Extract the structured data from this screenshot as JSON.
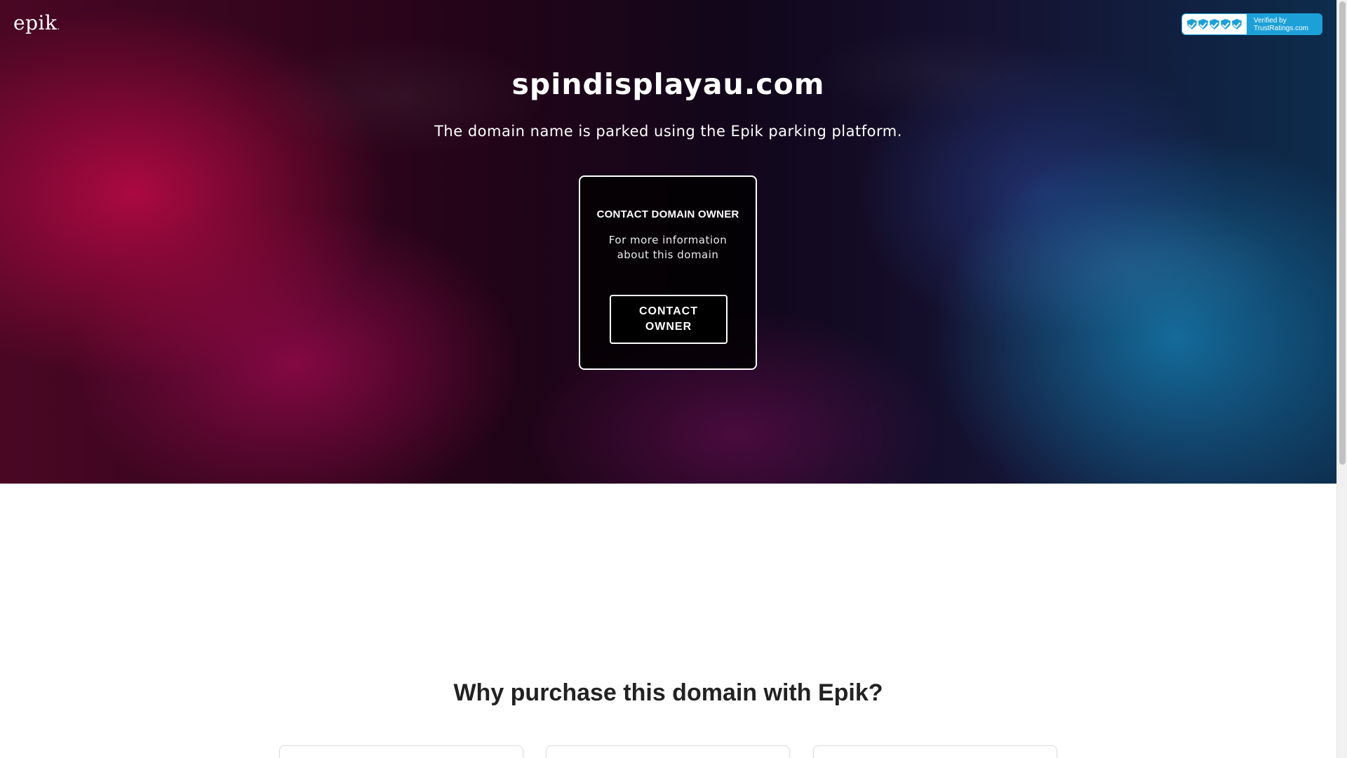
{
  "header": {
    "logo_text": "epik",
    "logo_dot": ".",
    "trust_badge": {
      "line1": "Verified by",
      "line2": "TrustRatings.com",
      "icon": "shield-check-icon",
      "shield_count": 5,
      "color": "#1da0d8"
    }
  },
  "hero": {
    "domain": "spindisplayau.com",
    "subtitle": "The domain name is parked using the Epik parking platform."
  },
  "contact_card": {
    "heading": "CONTACT DOMAIN OWNER",
    "description": "For more information about this domain",
    "button_label": "CONTACT OWNER"
  },
  "why_section": {
    "heading": "Why purchase this domain with Epik?"
  },
  "colors": {
    "hero_magenta": "#be0a46",
    "hero_blue": "#1478aa",
    "badge_blue": "#1da0d8"
  }
}
